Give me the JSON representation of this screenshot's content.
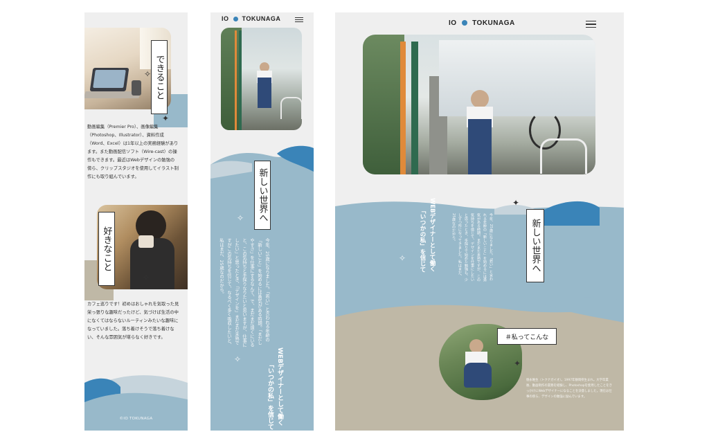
{
  "brand": {
    "left": "IO",
    "right": "TOKUNAGA"
  },
  "colors": {
    "blue": "#3a84b8",
    "lightblue": "#98b9ca",
    "beige": "#bfb8a6",
    "bg": "#efefef"
  },
  "panel1": {
    "tag_skill": "できること",
    "skill_text": "動画編集（Premier Pro）、画像編集（Photoshop、Illustrator）、資料作成（Word、Excel）は1年以上の実務経験があります。また動画配信ソフト（Wire-cast）の操作もできます。最近はWebデザインの勉強の傍ら、クリップスタジオを使用してイラスト制作にも取り組んでいます。",
    "tag_like": "好きなこと",
    "like_text": "カフェ巡りです！初めはおしゃれを気取った見栄っ張りな趣味だったけど、気づけば生活の中になくてはならないルーティンみたいな趣味になっていました。落ち着けそうで落ち着けない、そんな雰囲気が堪らなく好きです。",
    "footer": "©IO TOKUNAGA"
  },
  "panel2": {
    "tag_title": "新しい世界へ",
    "intro_text": "今年、25歳になりました。「若い」と言われる年齢の「新しいこと」を始めるには勇気がある時期。「まだしやすさ」を仕事にするなんて、で、まだまだ遠くにいると、この気持ちと手探りなりたいと思いますが、仕事にしたい」と思ったとき、「デザインを」まだまだ未熟ですがこの気持ちを信じて、なるべく多く吸収したいと、私はまだ、25歳なのだから。",
    "lead_a": "WEBデザイナーとして働く",
    "lead_b": "「いつかの私」を信じて"
  },
  "panel3": {
    "tag_title": "新しい世界へ",
    "lead_a": "WEBデザイナーとして働く",
    "lead_b": "「いつかの私」を信じて",
    "intro_text": "今年、25歳になりました。「若い」と言われる年齢の「新しいこと」を始めるには勇気がある時期。まだまだ未熟ですが、この気持ちを信じて、デザインを仕事にしたいと思ったとき、手探りで始めた勉強も、少しずつ形になってきました。私はまだ、25歳なのだから。",
    "tag_me": "＃私ってこんな",
    "profile_text": "徳永唯生（トクナガイオ）。1997年静岡県生まれ。大学卒業後、動画制作の業務を経験し、Photoshopを使用したことをきっかけにWebデザイナーになることを決意しました。現在は仕事の傍ら、デザインの勉強に励んでいます。"
  },
  "icons": {
    "menu": "hamburger-icon",
    "brand_dot": "circle-icon",
    "sparkle": "sparkle-icon"
  }
}
